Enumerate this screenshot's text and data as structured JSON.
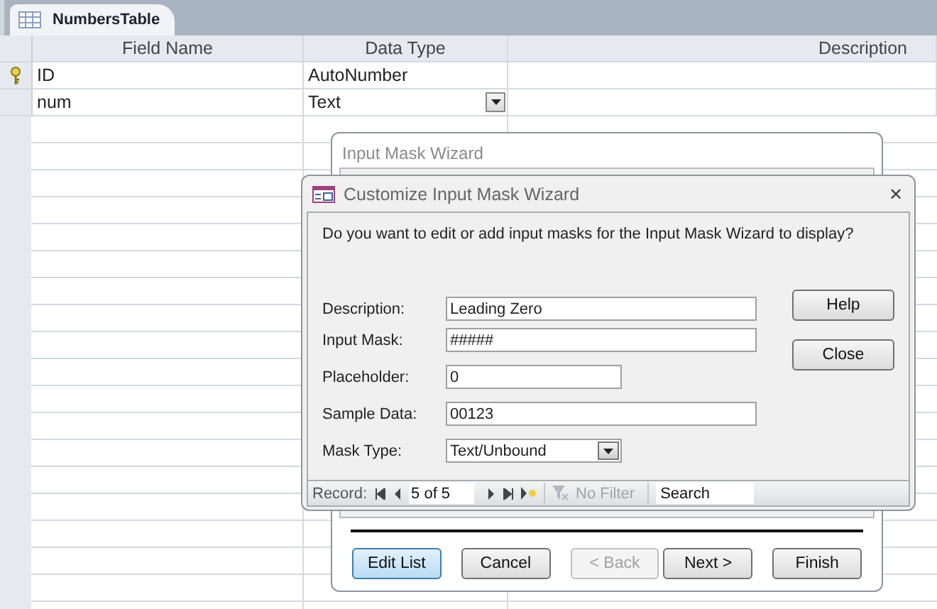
{
  "document_tab": {
    "title": "NumbersTable"
  },
  "table": {
    "columns": [
      "Field Name",
      "Data Type",
      "Description"
    ],
    "rows": [
      {
        "primary_key": true,
        "field_name": "ID",
        "data_type": "AutoNumber",
        "dropdown": false
      },
      {
        "primary_key": false,
        "field_name": "num",
        "data_type": "Text",
        "dropdown": true
      }
    ]
  },
  "back_dialog": {
    "title": "Input Mask Wizard",
    "buttons": [
      {
        "label": "Edit List",
        "focused": true,
        "disabled": false
      },
      {
        "label": "Cancel",
        "focused": false,
        "disabled": false
      },
      {
        "label": "< Back",
        "focused": false,
        "disabled": true
      },
      {
        "label": "Next >",
        "focused": false,
        "disabled": false
      },
      {
        "label": "Finish",
        "focused": false,
        "disabled": false
      }
    ]
  },
  "front_dialog": {
    "title": "Customize Input Mask Wizard",
    "close": "✕",
    "question": "Do you want to edit or add input masks for the Input Mask Wizard to display?",
    "fields": [
      {
        "kind": "text",
        "label": "Description:",
        "value": "Leading Zero"
      },
      {
        "kind": "text",
        "label": "Input Mask:",
        "value": "#####"
      },
      {
        "kind": "text",
        "label": "Placeholder:",
        "value": "0"
      },
      {
        "kind": "text",
        "label": "Sample Data:",
        "value": "00123"
      },
      {
        "kind": "combo",
        "label": "Mask Type:",
        "value": "Text/Unbound"
      }
    ],
    "buttons": [
      "Help",
      "Close"
    ],
    "record_bar": {
      "label": "Record:",
      "position": "5 of 5",
      "filter": "No Filter",
      "search_placeholder": "Search"
    }
  }
}
